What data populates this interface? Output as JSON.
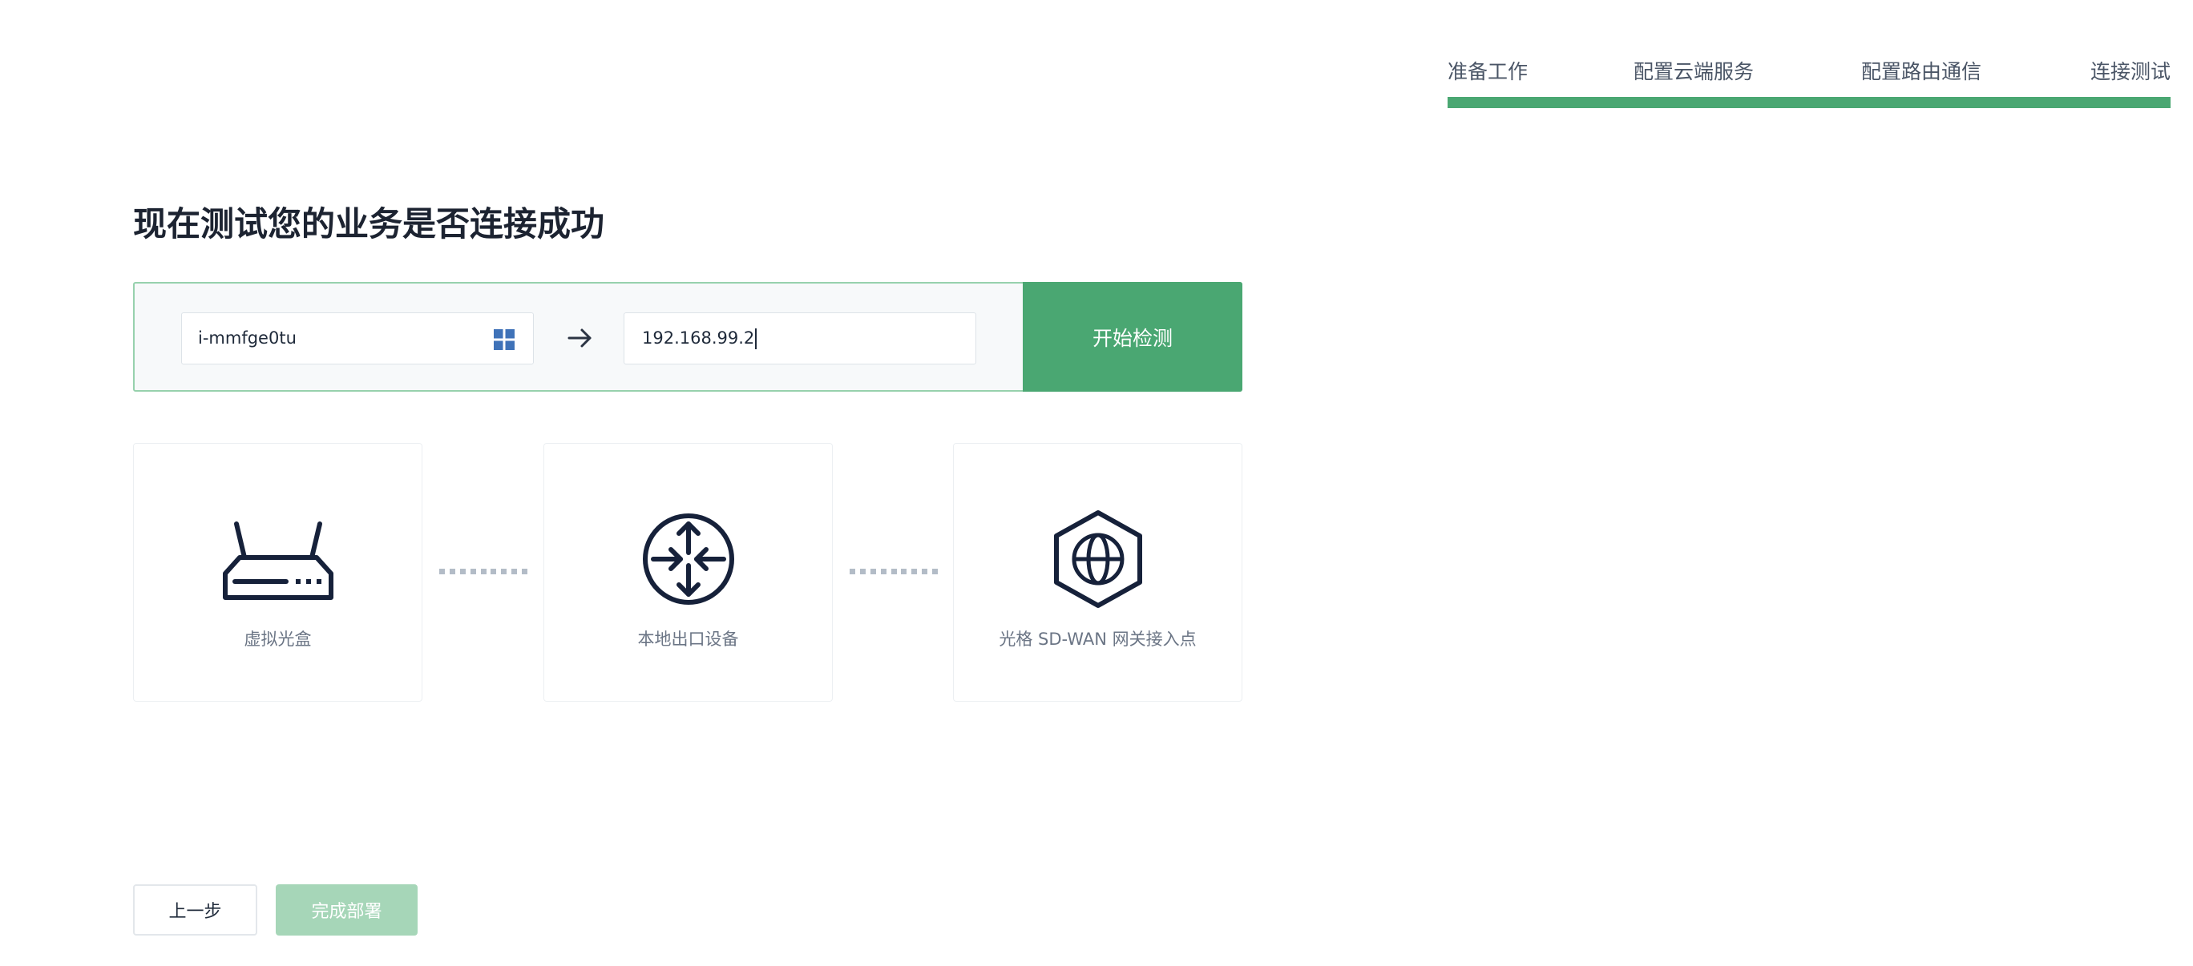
{
  "stepper": {
    "steps": [
      {
        "label": "准备工作"
      },
      {
        "label": "配置云端服务"
      },
      {
        "label": "配置路由通信"
      },
      {
        "label": "连接测试"
      }
    ],
    "progress": 1.0,
    "accent_color": "#4aa772"
  },
  "title": "现在测试您的业务是否连接成功",
  "test": {
    "source_value": "i-mmfge0tu",
    "source_icon": "windows-icon",
    "arrow_icon": "arrow-right-icon",
    "target_value": "192.168.99.2",
    "start_label": "开始检测"
  },
  "nodes": [
    {
      "label": "虚拟光盒",
      "icon": "router-icon"
    },
    {
      "label": "本地出口设备",
      "icon": "gateway-icon"
    },
    {
      "label": "光格 SD-WAN 网关接入点",
      "icon": "globe-hexagon-icon"
    }
  ],
  "footer": {
    "prev_label": "上一步",
    "done_label": "完成部署"
  }
}
